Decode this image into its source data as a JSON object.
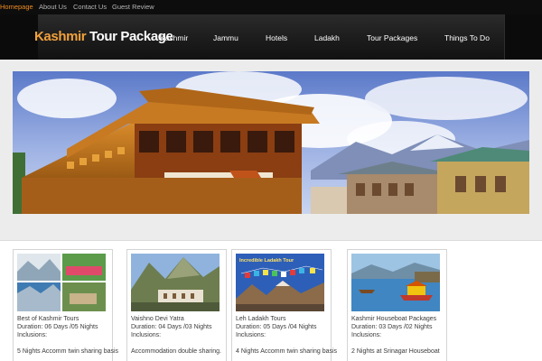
{
  "topbar": {
    "links": [
      {
        "label": "Homepage",
        "active": true
      },
      {
        "label": "About Us"
      },
      {
        "label": "Contact Us"
      },
      {
        "label": "Guest Review"
      }
    ]
  },
  "header": {
    "logo_brand": "Kashmir",
    "logo_rest": " Tour Package",
    "nav": [
      "Kashmir",
      "Jammu",
      "Hotels",
      "Ladakh",
      "Tour Packages",
      "Things To Do"
    ]
  },
  "banner": {
    "image": "kashmir-houseboat-photo"
  },
  "cards": [
    {
      "title": "Best of Kashmir Tours",
      "duration": "Duration: 06 Days /05 Nights",
      "inclusions": "Inclusions:",
      "desc": "5 Nights Accomm twin sharing basis",
      "image": "kashmir-collage-photo"
    },
    {
      "title": "Vaishno Devi Yatra",
      "duration": "Duration: 04 Days /03 Nights",
      "inclusions": "Inclusions:",
      "desc": "Accommodation double sharing.",
      "image": "vaishno-devi-photo"
    },
    {
      "title": "Leh Ladakh Tours",
      "duration": "Duration: 05 Days /04 Nights",
      "inclusions": "Inclusions:",
      "desc": "4 Nights Accomm twin sharing basis",
      "image": "ladakh-prayer-flags-photo",
      "image_caption": "Incredible Ladakh Tour"
    },
    {
      "title": "Kashmir Houseboat Packages",
      "duration": "Duration: 03 Days /02 Nights",
      "inclusions": "Inclusions:",
      "desc": "2 Nights at Srinagar Houseboat",
      "image": "shikara-lake-photo"
    }
  ],
  "colors": {
    "accent": "#f08c1e",
    "logo": "#f2a13b",
    "header_dark": "#1c1c1c",
    "topbar": "#0d0d0d"
  }
}
